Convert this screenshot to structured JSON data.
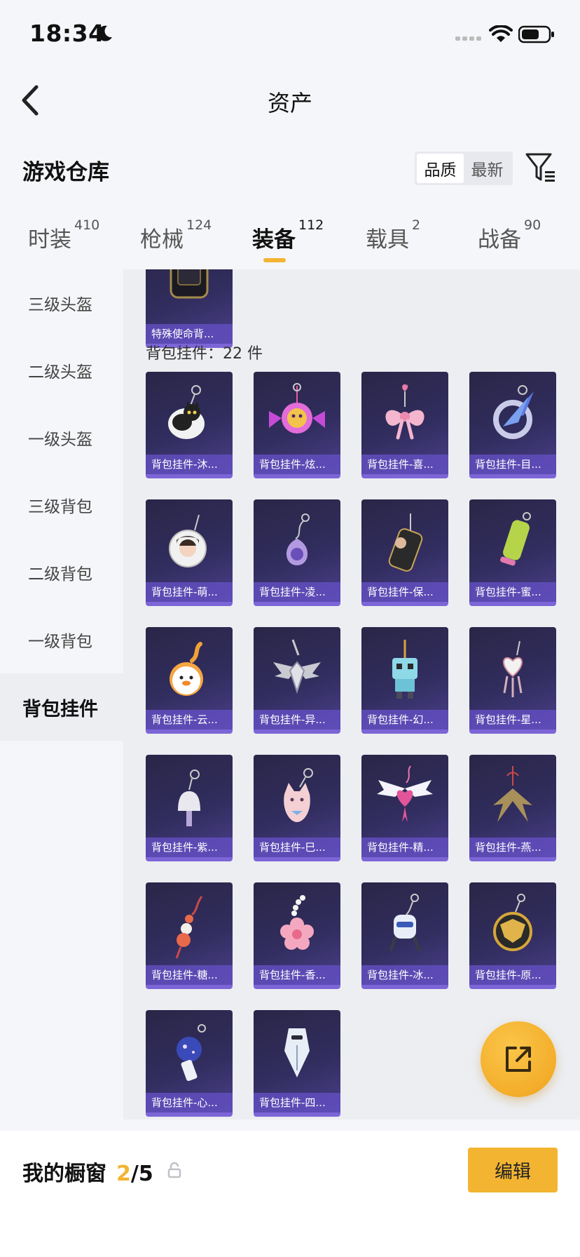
{
  "status_bar": {
    "time": "18:34"
  },
  "nav": {
    "title": "资产"
  },
  "section": {
    "title": "游戏仓库",
    "sort_options": [
      {
        "label": "品质",
        "active": true
      },
      {
        "label": "最新",
        "active": false
      }
    ]
  },
  "tabs": [
    {
      "label": "时装",
      "count": "410"
    },
    {
      "label": "枪械",
      "count": "124"
    },
    {
      "label": "装备",
      "count": "112",
      "active": true
    },
    {
      "label": "载具",
      "count": "2"
    },
    {
      "label": "战备",
      "count": "90"
    }
  ],
  "sidebar": {
    "items": [
      {
        "label": "三级头盔"
      },
      {
        "label": "二级头盔"
      },
      {
        "label": "一级头盔"
      },
      {
        "label": "三级背包"
      },
      {
        "label": "二级背包"
      },
      {
        "label": "一级背包"
      },
      {
        "label": "背包挂件",
        "active": true
      }
    ]
  },
  "content": {
    "prev_item": {
      "label": "特殊使命背...",
      "icon": "backpack-icon"
    },
    "group_heading": "背包挂件：22 件",
    "items": [
      {
        "label": "背包挂件-沐...",
        "icon": "cat-charm-icon"
      },
      {
        "label": "背包挂件-炫...",
        "icon": "candy-charm-icon"
      },
      {
        "label": "背包挂件-喜...",
        "icon": "bow-charm-icon"
      },
      {
        "label": "背包挂件-目...",
        "icon": "crescent-charm-icon"
      },
      {
        "label": "背包挂件-萌...",
        "icon": "portrait-badge-icon"
      },
      {
        "label": "背包挂件-凌...",
        "icon": "orb-charm-icon"
      },
      {
        "label": "背包挂件-保...",
        "icon": "phone-charm-icon"
      },
      {
        "label": "背包挂件-蜜...",
        "icon": "popsicle-charm-icon"
      },
      {
        "label": "背包挂件-云...",
        "icon": "duck-charm-icon"
      },
      {
        "label": "背包挂件-异...",
        "icon": "wing-emblem-icon"
      },
      {
        "label": "背包挂件-幻...",
        "icon": "robot-charm-icon"
      },
      {
        "label": "背包挂件-星...",
        "icon": "heart-dreamcatcher-icon"
      },
      {
        "label": "背包挂件-紫...",
        "icon": "bell-charm-icon"
      },
      {
        "label": "背包挂件-巳...",
        "icon": "fox-charm-icon"
      },
      {
        "label": "背包挂件-精...",
        "icon": "winged-heart-icon"
      },
      {
        "label": "背包挂件-燕...",
        "icon": "swallow-charm-icon"
      },
      {
        "label": "背包挂件-糖...",
        "icon": "gourd-tassel-icon"
      },
      {
        "label": "背包挂件-香...",
        "icon": "flower-charm-icon"
      },
      {
        "label": "背包挂件-冰...",
        "icon": "mini-robot-icon"
      },
      {
        "label": "背包挂件-原...",
        "icon": "gold-badge-icon"
      },
      {
        "label": "背包挂件-心...",
        "icon": "galaxy-orb-icon"
      },
      {
        "label": "背包挂件-四...",
        "icon": "mech-charm-icon"
      }
    ]
  },
  "showcase": {
    "label": "我的橱窗",
    "current": "2",
    "separator": "/",
    "max": "5"
  },
  "edit_button": {
    "label": "编辑"
  },
  "colors": {
    "accent": "#f3b431",
    "card_bg": "#312d5e",
    "card_label": "#624ebe"
  }
}
